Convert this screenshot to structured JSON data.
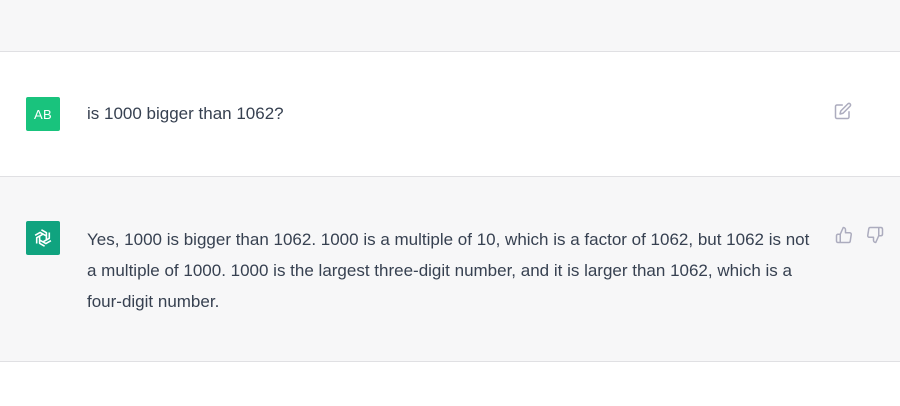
{
  "conversation": {
    "user_message": {
      "avatar_initials": "AB",
      "avatar_color": "#19c37d",
      "text": "is 1000 bigger than 1062?",
      "edit_icon": "edit-icon"
    },
    "assistant_message": {
      "avatar_icon": "openai-logo-icon",
      "avatar_color": "#10a37f",
      "text": "Yes, 1000 is bigger than 1062. 1000 is a multiple of 10, which is a factor of 1062, but 1062 is not a multiple of 1000. 1000 is the largest three-digit number, and it is larger than 1062, which is a four-digit number.",
      "feedback_icons": [
        "thumbs-up-icon",
        "thumbs-down-icon"
      ]
    }
  },
  "colors": {
    "band_background": "#f7f7f8",
    "text": "#374151",
    "icon": "#acacbe"
  }
}
